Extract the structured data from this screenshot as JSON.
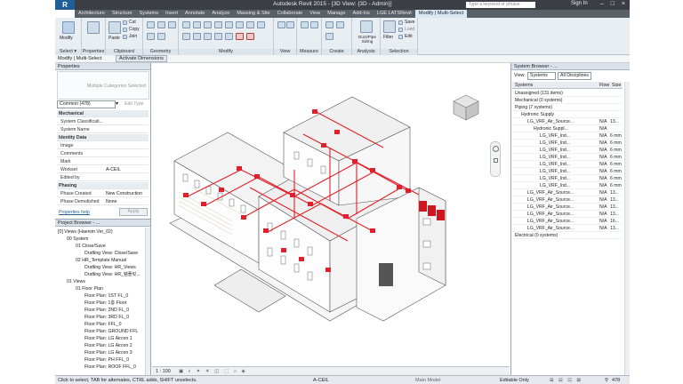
{
  "app": {
    "logo": "R",
    "window_title": "Autodesk Revit 2015 - [3D View: {3D - Admin}]",
    "search_placeholder": "Type a keyword or phrase",
    "sign_in": "Sign In",
    "window_controls": "– □ ×"
  },
  "tabs": [
    "Architecture",
    "Structure",
    "Systems",
    "Insert",
    "Annotate",
    "Analyze",
    "Massing & Site",
    "Collaborate",
    "View",
    "Manage",
    "Add-Ins",
    "LGE LATSRevit",
    "Modify | Multi-Select"
  ],
  "active_tab_index": 12,
  "ribbon": {
    "groups": [
      {
        "label": "Select ▾",
        "buttons": [
          "Modify"
        ]
      },
      {
        "label": "Properties",
        "buttons": [
          "Properties"
        ]
      },
      {
        "label": "Clipboard",
        "buttons": [
          "Paste",
          "Cut",
          "Copy",
          "Join"
        ]
      },
      {
        "label": "Geometry",
        "buttons": []
      },
      {
        "label": "Modify",
        "buttons": []
      },
      {
        "label": "View",
        "buttons": []
      },
      {
        "label": "Measure",
        "buttons": []
      },
      {
        "label": "Create",
        "buttons": []
      },
      {
        "label": "Analysis",
        "buttons": [
          "Duct/Pipe Sizing"
        ]
      },
      {
        "label": "Selection",
        "buttons": [
          "Filter",
          "Save",
          "Load",
          "Edit"
        ]
      }
    ]
  },
  "option_bar": {
    "context": "Modify | Multi-Select",
    "action": "Activate Dimensions"
  },
  "properties": {
    "title": "Properties",
    "type_label": "Multiple Categories Selected",
    "filter_value": "Common (478)",
    "edit_type": "Edit Type",
    "rows": [
      {
        "k": "Mechanical",
        "v": "",
        "cat": true
      },
      {
        "k": "System Classificati...",
        "v": "",
        "cat": false
      },
      {
        "k": "System Name",
        "v": "",
        "cat": false
      },
      {
        "k": "Identity Data",
        "v": "",
        "cat": true
      },
      {
        "k": "Image",
        "v": "",
        "cat": false
      },
      {
        "k": "Comments",
        "v": "",
        "cat": false
      },
      {
        "k": "Mark",
        "v": "",
        "cat": false
      },
      {
        "k": "Workset",
        "v": "A-CEIL",
        "cat": false
      },
      {
        "k": "Edited by",
        "v": "",
        "cat": false
      },
      {
        "k": "Phasing",
        "v": "",
        "cat": true
      },
      {
        "k": "Phase Created",
        "v": "New Construction",
        "cat": false
      },
      {
        "k": "Phase Demolished",
        "v": "None",
        "cat": false
      }
    ],
    "help_link": "Properties help",
    "apply": "Apply"
  },
  "project_browser": {
    "title": "Project Browser - ...",
    "items": [
      {
        "t": "[0] Views (Haenim Ver_02)",
        "i": 0
      },
      {
        "t": "00 System",
        "i": 1
      },
      {
        "t": "01 Close/Save",
        "i": 2
      },
      {
        "t": "Drafting View: Close/Save",
        "i": 3
      },
      {
        "t": "02 HR_Template Manual",
        "i": 2
      },
      {
        "t": "Drafting View: HR_Views",
        "i": 3
      },
      {
        "t": "Drafting View: HR_템플릿...",
        "i": 3
      },
      {
        "t": "01 Views",
        "i": 1
      },
      {
        "t": "01 Floor Plan",
        "i": 2
      },
      {
        "t": "Floor Plan: 1ST FL_0",
        "i": 3
      },
      {
        "t": "Floor Plan: 1층 Floor",
        "i": 3
      },
      {
        "t": "Floor Plan: 2ND FL_0",
        "i": 3
      },
      {
        "t": "Floor Plan: 3RD FL_0",
        "i": 3
      },
      {
        "t": "Floor Plan: FFL_0",
        "i": 3
      },
      {
        "t": "Floor Plan: GROUND FFL",
        "i": 3
      },
      {
        "t": "Floor Plan: LG Aircon 1",
        "i": 3
      },
      {
        "t": "Floor Plan: LG Aircon 2",
        "i": 3
      },
      {
        "t": "Floor Plan: LG Aircon 3",
        "i": 3
      },
      {
        "t": "Floor Plan: PH FFL_0",
        "i": 3
      },
      {
        "t": "Floor Plan: ROOF FFL_0",
        "i": 3
      }
    ]
  },
  "view_status": {
    "scale": "1 : 100",
    "workset": "A-CEIL",
    "model": "Main Model"
  },
  "system_browser": {
    "title": "System Browser - ...",
    "view_label": "View:",
    "view_value": "Systems",
    "discipline_value": "All Disciplines",
    "columns": [
      "Systems",
      "Flow",
      "Size"
    ],
    "rows": [
      {
        "n": "Unassigned (131 items)",
        "f": "",
        "s": "",
        "i": 0
      },
      {
        "n": "Mechanical (0 systems)",
        "f": "",
        "s": "",
        "i": 0
      },
      {
        "n": "Piping (7 systems)",
        "f": "",
        "s": "",
        "i": 0
      },
      {
        "n": "Hydronic Supply",
        "f": "",
        "s": "",
        "i": 1
      },
      {
        "n": "LG_VRF_Air_Source...",
        "f": "N/A",
        "s": "13...",
        "i": 2
      },
      {
        "n": "Hydronic Suppl...",
        "f": "N/A",
        "s": "",
        "i": 3
      },
      {
        "n": "LG_VRF_Ind...",
        "f": "N/A",
        "s": "6 mm",
        "i": 4
      },
      {
        "n": "LG_VRF_Ind...",
        "f": "N/A",
        "s": "6 mm",
        "i": 4
      },
      {
        "n": "LG_VRF_Ind...",
        "f": "N/A",
        "s": "6 mm",
        "i": 4
      },
      {
        "n": "LG_VRF_Ind...",
        "f": "N/A",
        "s": "6 mm",
        "i": 4
      },
      {
        "n": "LG_VRF_Ind...",
        "f": "N/A",
        "s": "6 mm",
        "i": 4
      },
      {
        "n": "LG_VRF_Ind...",
        "f": "N/A",
        "s": "6 mm",
        "i": 4
      },
      {
        "n": "LG_VRF_Ind...",
        "f": "N/A",
        "s": "6 mm",
        "i": 4
      },
      {
        "n": "LG_VRF_Ind...",
        "f": "N/A",
        "s": "6 mm",
        "i": 4
      },
      {
        "n": "LG_VRF_Air_Source...",
        "f": "N/A",
        "s": "13...",
        "i": 2
      },
      {
        "n": "LG_VRF_Air_Source...",
        "f": "N/A",
        "s": "13...",
        "i": 2
      },
      {
        "n": "LG_VRF_Air_Source...",
        "f": "N/A",
        "s": "13...",
        "i": 2
      },
      {
        "n": "LG_VRF_Air_Source...",
        "f": "N/A",
        "s": "13...",
        "i": 2
      },
      {
        "n": "LG_VRF_Air_Source...",
        "f": "N/A",
        "s": "16...",
        "i": 2
      },
      {
        "n": "LG_VRF_Air_Source...",
        "f": "N/A",
        "s": "13...",
        "i": 2
      },
      {
        "n": "Electrical (0 systems)",
        "f": "",
        "s": "",
        "i": 0
      }
    ]
  },
  "status_bar": {
    "hint": "Click to select, TAB for alternates, CTRL adds, SHIFT unselects.",
    "workset": "A-CEIL",
    "model": "Main Model",
    "editable_only": "Editable Only",
    "count": "478"
  },
  "colors": {
    "accent": "#1f5f96",
    "pipe_red": "#e0202a",
    "ribbon_bg": "#e9eef3"
  }
}
